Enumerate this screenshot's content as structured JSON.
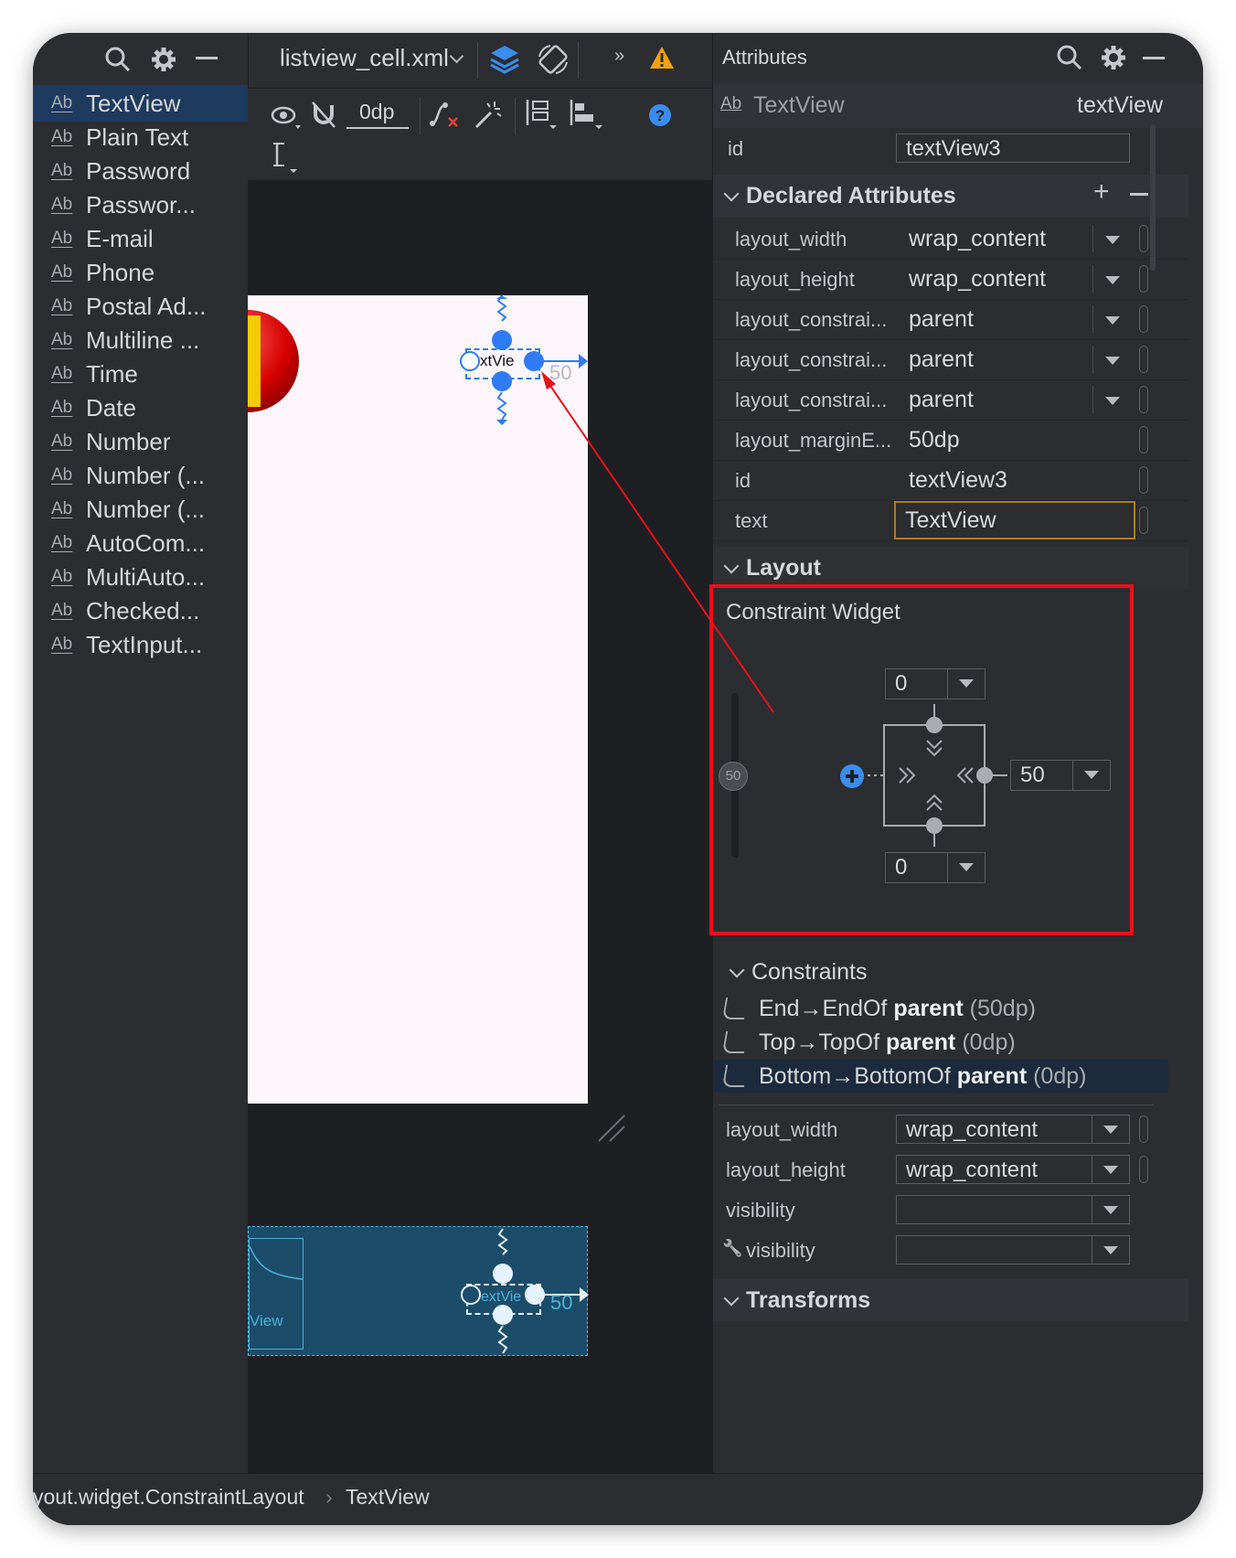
{
  "palette": {
    "items": [
      {
        "label": "TextView",
        "selected": true
      },
      {
        "label": "Plain Text"
      },
      {
        "label": "Password"
      },
      {
        "label": "Passwor..."
      },
      {
        "label": "E-mail"
      },
      {
        "label": "Phone"
      },
      {
        "label": "Postal Ad..."
      },
      {
        "label": "Multiline ..."
      },
      {
        "label": "Time"
      },
      {
        "label": "Date"
      },
      {
        "label": "Number"
      },
      {
        "label": "Number (..."
      },
      {
        "label": "Number (..."
      },
      {
        "label": "AutoCom..."
      },
      {
        "label": "MultiAuto..."
      },
      {
        "label": "Checked..."
      },
      {
        "label": "TextInput..."
      }
    ],
    "ab_icon": "Ab"
  },
  "editor": {
    "file_tab": "listview_cell.xml",
    "margin_value": "0dp",
    "canvas_label": "xtVie",
    "canvas_margin": "50",
    "blueprint_label": "extVie",
    "blueprint_left_label": "View",
    "blueprint_margin": "50"
  },
  "attributes": {
    "title": "Attributes",
    "component_type": "TextView",
    "component_name": "textView",
    "id_label": "id",
    "id_value": "textView3",
    "declared": {
      "title": "Declared Attributes",
      "rows": [
        {
          "key": "layout_width",
          "value": "wrap_content",
          "dropdown": true
        },
        {
          "key": "layout_height",
          "value": "wrap_content",
          "dropdown": true
        },
        {
          "key": "layout_constrai...",
          "value": "parent",
          "dropdown": true
        },
        {
          "key": "layout_constrai...",
          "value": "parent",
          "dropdown": true
        },
        {
          "key": "layout_constrai...",
          "value": "parent",
          "dropdown": true
        },
        {
          "key": "layout_marginE...",
          "value": "50dp",
          "dropdown": false
        },
        {
          "key": "id",
          "value": "textView3",
          "dropdown": false
        },
        {
          "key": "text",
          "value": "TextView",
          "dropdown": false,
          "highlight": true
        }
      ]
    },
    "layout": {
      "title": "Layout",
      "widget_title": "Constraint Widget",
      "top_margin": "0",
      "end_margin": "50",
      "bottom_margin": "0",
      "bias": "50"
    },
    "constraints": {
      "title": "Constraints",
      "items": [
        {
          "side": "End",
          "target": "EndOf",
          "parent": "parent",
          "dp": "(50dp)"
        },
        {
          "side": "Top",
          "target": "TopOf",
          "parent": "parent",
          "dp": "(0dp)"
        },
        {
          "side": "Bottom",
          "target": "BottomOf",
          "parent": "parent",
          "dp": "(0dp)",
          "selected": true
        }
      ]
    },
    "common": [
      {
        "key": "layout_width",
        "value": "wrap_content"
      },
      {
        "key": "layout_height",
        "value": "wrap_content"
      },
      {
        "key": "visibility",
        "value": ""
      },
      {
        "key": "visibility",
        "value": "",
        "tool": true
      }
    ],
    "transforms_title": "Transforms"
  },
  "breadcrumb": {
    "path": "yout.widget.ConstraintLayout",
    "current": "TextView"
  },
  "colors": {
    "accent": "#2f7bf5",
    "highlight_box": "#e8101b",
    "text_field_border": "#b07a1f"
  }
}
